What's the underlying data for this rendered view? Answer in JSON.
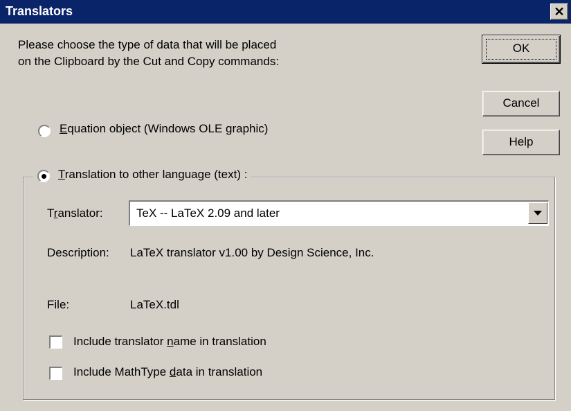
{
  "window": {
    "title": "Translators",
    "close_glyph": "✕"
  },
  "prompt": {
    "line1": "Please choose the type of data that will be placed",
    "line2": "on the Clipboard by the Cut and Copy commands:"
  },
  "buttons": {
    "ok": "OK",
    "cancel": "Cancel",
    "help": "Help"
  },
  "options": {
    "equation": {
      "accel": "E",
      "rest": "quation object (Windows OLE graphic)",
      "selected": false
    },
    "translation": {
      "accel": "T",
      "rest": "ranslation to other language (text) :",
      "selected": true
    }
  },
  "translator": {
    "label_pre": "T",
    "label_accel": "r",
    "label_post": "anslator:",
    "value": "TeX -- LaTeX 2.09 and later"
  },
  "description": {
    "label": "Description:",
    "value": "LaTeX translator v1.00 by Design Science, Inc."
  },
  "file": {
    "label": "File:",
    "value": "LaTeX.tdl"
  },
  "checkboxes": {
    "name": {
      "pre": "Include translator ",
      "accel": "n",
      "post": "ame in translation",
      "checked": false
    },
    "mathtype": {
      "pre": "Include MathType ",
      "accel": "d",
      "post": "ata in translation",
      "checked": false
    }
  },
  "icons": {
    "close": "close-icon",
    "dropdown": "chevron-down-icon"
  }
}
